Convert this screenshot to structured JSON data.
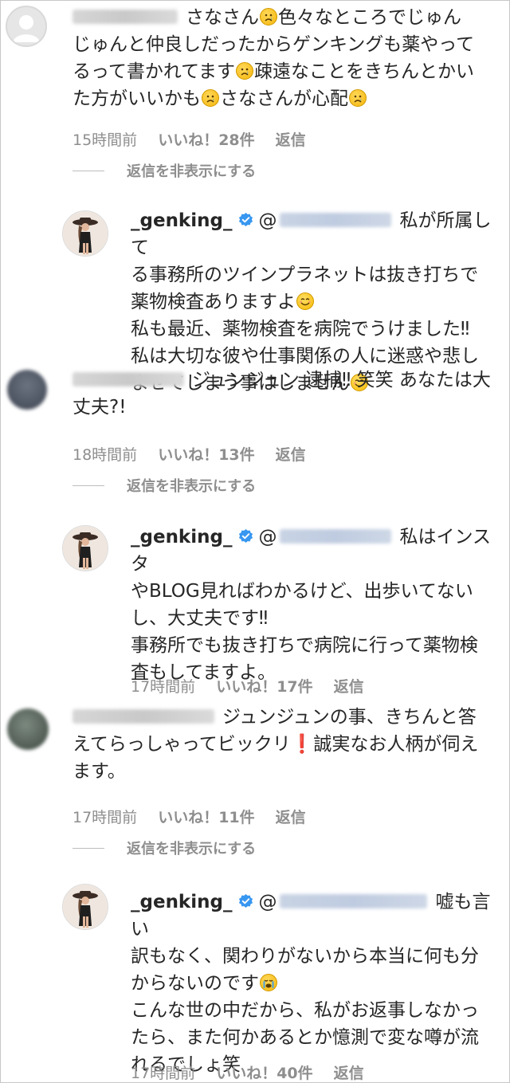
{
  "comments": [
    {
      "text": "さなさん😢色々なところでじゅんじゅんと仲良しだったからゲンキングも薬やってるって書かれてます😢疎遠なことをきちんとかいた方がいいかも😢さなさんが心配😢",
      "line1a": "さなさん",
      "line1b": "色々なところでじゅん",
      "line2": "じゅんと仲良しだったからゲンキングも薬やって",
      "line3a": "るって書かれてます",
      "line3b": "疎遠なことをきちんとかい",
      "line4a": "た方がいいかも",
      "line4b": "さなさんが心配",
      "time": "15時間前",
      "likes": "いいね！28件",
      "reply": "返信",
      "hide": "返信を非表示にする",
      "reply_obj": {
        "username": "_genking_",
        "at": "@",
        "l1": "私が所属して",
        "l2": "る事務所のツインプラネットは抜き打ちで",
        "l3": "薬物検査ありますよ",
        "l4": "私も最近、薬物検査を病院でうけました‼",
        "l5": "私は大切な彼や仕事関係の人に迷惑や悲し",
        "l6": "ませてしまう事はしません"
      }
    },
    {
      "l1": "ジュンジュン 逮捕‼ 笑笑 あなたは大",
      "l2": "丈夫?!",
      "time": "18時間前",
      "likes": "いいね！13件",
      "reply": "返信",
      "hide": "返信を非表示にする",
      "reply_obj": {
        "username": "_genking_",
        "at": "@",
        "l1": "私はインスタ",
        "l2": "やBLOG見ればわかるけど、出歩いてない",
        "l3": "し、大丈夫です‼",
        "l4": "事務所でも抜き打ちで病院に行って薬物検",
        "l5": "査もしてますよ。",
        "time": "17時間前",
        "likes": "いいね！17件",
        "reply": "返信"
      }
    },
    {
      "l1": "ジュンジュンの事、きちんと答",
      "l2a": "えてらっしゃってビックリ",
      "exclaim": "❗",
      "l2b": "誠実なお人柄が伺え",
      "l3": "ます。",
      "time": "17時間前",
      "likes": "いいね！11件",
      "reply": "返信",
      "hide": "返信を非表示にする",
      "reply_obj": {
        "username": "_genking_",
        "at": "@",
        "l1": "嘘も言い",
        "l2": "訳もなく、関わりがないから本当に何も分",
        "l3": "からないのです",
        "l4": "こんな世の中だから、私がお返事しなかっ",
        "l5": "たら、また何かあるとか憶測で変な噂が流",
        "l6": "れるでしょ笑",
        "time": "17時間前",
        "likes": "いいね！40件",
        "reply": "返信"
      }
    }
  ],
  "icons": {
    "verified": "verified-badge-icon",
    "emoji_sad": "sad-face-emoji",
    "emoji_smile": "smiling-face-emoji",
    "emoji_cry": "crying-face-emoji",
    "exclaim": "red-exclamation-emoji"
  },
  "colors": {
    "text": "#262626",
    "muted": "#8e8e8e",
    "verified": "#3897f0",
    "border": "#c7c7c7"
  }
}
